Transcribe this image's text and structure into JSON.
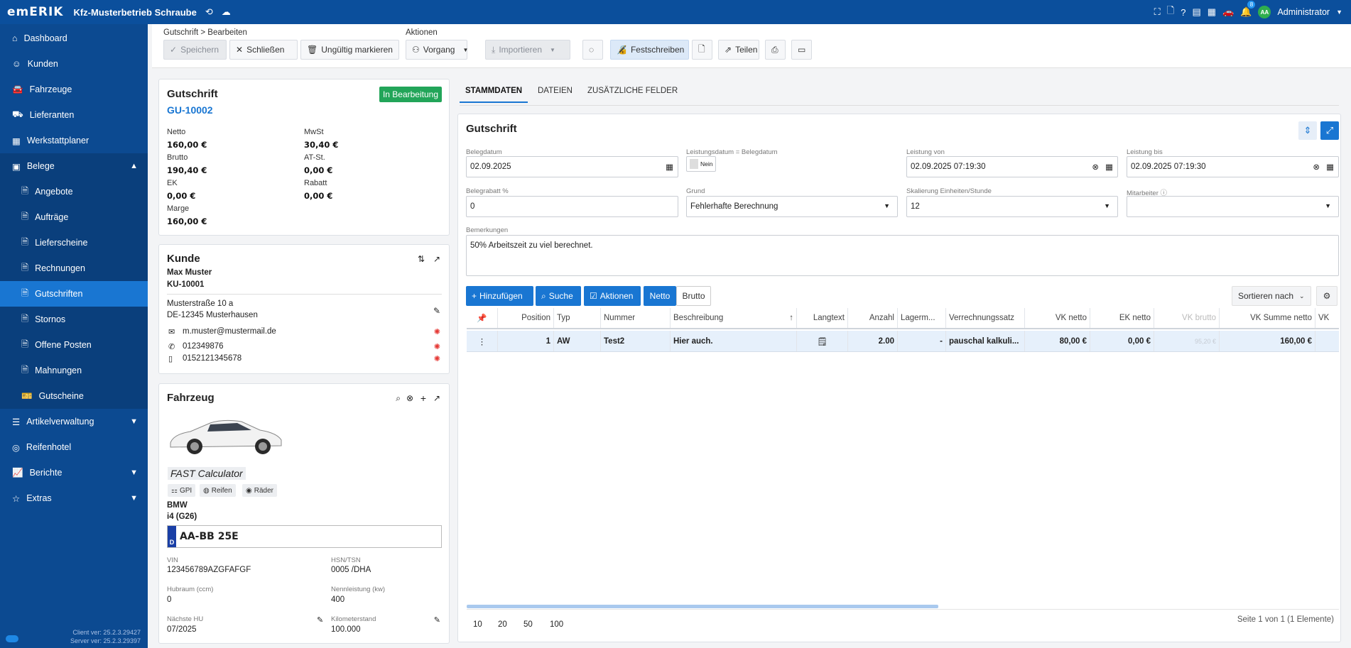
{
  "topbar": {
    "logo": "emERIK",
    "company": "Kfz-Musterbetrieb Schraube",
    "notif_count": "8",
    "avatar": "AA",
    "user": "Administrator"
  },
  "sidebar": {
    "items": [
      {
        "label": "Dashboard",
        "icon": "home-icon"
      },
      {
        "label": "Kunden",
        "icon": "user-icon"
      },
      {
        "label": "Fahrzeuge",
        "icon": "car-icon"
      },
      {
        "label": "Lieferanten",
        "icon": "truck-icon"
      },
      {
        "label": "Werkstattplaner",
        "icon": "calendar-icon"
      },
      {
        "label": "Belege",
        "icon": "document-icon"
      },
      {
        "label": "Angebote"
      },
      {
        "label": "Aufträge"
      },
      {
        "label": "Lieferscheine"
      },
      {
        "label": "Rechnungen"
      },
      {
        "label": "Gutschriften"
      },
      {
        "label": "Stornos"
      },
      {
        "label": "Offene Posten"
      },
      {
        "label": "Mahnungen"
      },
      {
        "label": "Gutscheine"
      },
      {
        "label": "Artikelverwaltung"
      },
      {
        "label": "Reifenhotel"
      },
      {
        "label": "Berichte"
      },
      {
        "label": "Extras"
      }
    ],
    "client_version": "Client ver: 25.2.3.29427",
    "server_version": "Server ver: 25.2.3.29397"
  },
  "toolbar": {
    "breadcrumb": "Gutschrift > Bearbeiten",
    "actions_label": "Aktionen",
    "save": "Speichern",
    "close": "Schließen",
    "invalid": "Ungültig markieren",
    "process": "Vorgang",
    "import": "Importieren",
    "finalize": "Festschreiben",
    "share": "Teilen"
  },
  "summary": {
    "title": "Gutschrift",
    "number": "GU-10002",
    "status": "In Bearbeitung",
    "netto_label": "Netto",
    "netto": "160,00 €",
    "mwst_label": "MwSt",
    "mwst": "30,40 €",
    "brutto_label": "Brutto",
    "brutto": "190,40 €",
    "at_label": "AT-St.",
    "at": "0,00 €",
    "ek_label": "EK",
    "ek": "0,00 €",
    "rabatt_label": "Rabatt",
    "rabatt": "0,00 €",
    "marge_label": "Marge",
    "marge": "160,00 €"
  },
  "customer": {
    "title": "Kunde",
    "name": "Max Muster",
    "number": "KU-10001",
    "street": "Musterstraße 10 a",
    "city": "DE-12345 Musterhausen",
    "email": "m.muster@mustermail.de",
    "phone": "012349876",
    "mobile": "0152121345678"
  },
  "vehicle": {
    "title": "Fahrzeug",
    "fast": "FAST Calculator",
    "chip_gpi": "GPI",
    "chip_tires": "Reifen",
    "chip_wheels": "Räder",
    "make": "BMW",
    "model": "i4 (G26)",
    "plate_country": "D",
    "plate": "AA-BB 25E",
    "vin_label": "VIN",
    "vin": "123456789AZGFAFGF",
    "hsn_label": "HSN/TSN",
    "hsn": "0005 /DHA",
    "hubraum_label": "Hubraum (ccm)",
    "hubraum": "0",
    "power_label": "Nennleistung (kw)",
    "power": "400",
    "hu_label": "Nächste HU",
    "hu": "07/2025",
    "km_label": "Kilometerstand",
    "km": "100.000"
  },
  "tabs": [
    "STAMMDATEN",
    "DATEIEN",
    "ZUSÄTZLICHE FELDER"
  ],
  "form": {
    "title": "Gutschrift",
    "belegdatum_label": "Belegdatum",
    "belegdatum": "02.09.2025",
    "leistung_eq_label": "Leistungsdatum = Belegdatum",
    "leistung_eq": "Nein",
    "leistung_von_label": "Leistung von",
    "leistung_von": "02.09.2025 07:19:30",
    "leistung_bis_label": "Leistung bis",
    "leistung_bis": "02.09.2025 07:19:30",
    "rabatt_label": "Belegrabatt %",
    "rabatt": "0",
    "grund_label": "Grund",
    "grund": "Fehlerhafte Berechnung",
    "skal_label": "Skalierung Einheiten/Stunde",
    "skal": "12",
    "mitarbeiter_label": "Mitarbeiter",
    "bemerk_label": "Bemerkungen",
    "bemerk": "50% Arbeitszeit zu viel berechnet."
  },
  "grid": {
    "add": "Hinzufügen",
    "search": "Suche",
    "actions": "Aktionen",
    "netto": "Netto",
    "brutto": "Brutto",
    "sort": "Sortieren nach",
    "headers": [
      "Position",
      "Typ",
      "Nummer",
      "Beschreibung",
      "Langtext",
      "Anzahl",
      "Lagerm...",
      "Verrechnungssatz",
      "VK netto",
      "EK netto",
      "VK brutto",
      "VK Summe netto",
      "VK"
    ],
    "row": {
      "position": "1",
      "typ": "AW",
      "nummer": "Test2",
      "beschreibung": "Hier auch.",
      "anzahl": "2.00",
      "lager": "-",
      "satz": "pauschal kalkuli...",
      "vk_netto": "80,00 €",
      "ek_netto": "0,00 €",
      "vk_brutto": "95,20 €",
      "vk_summe": "160,00 €"
    },
    "page_sizes": [
      "10",
      "20",
      "50",
      "100"
    ],
    "paging": "Seite 1 von 1 (1 Elemente)"
  }
}
